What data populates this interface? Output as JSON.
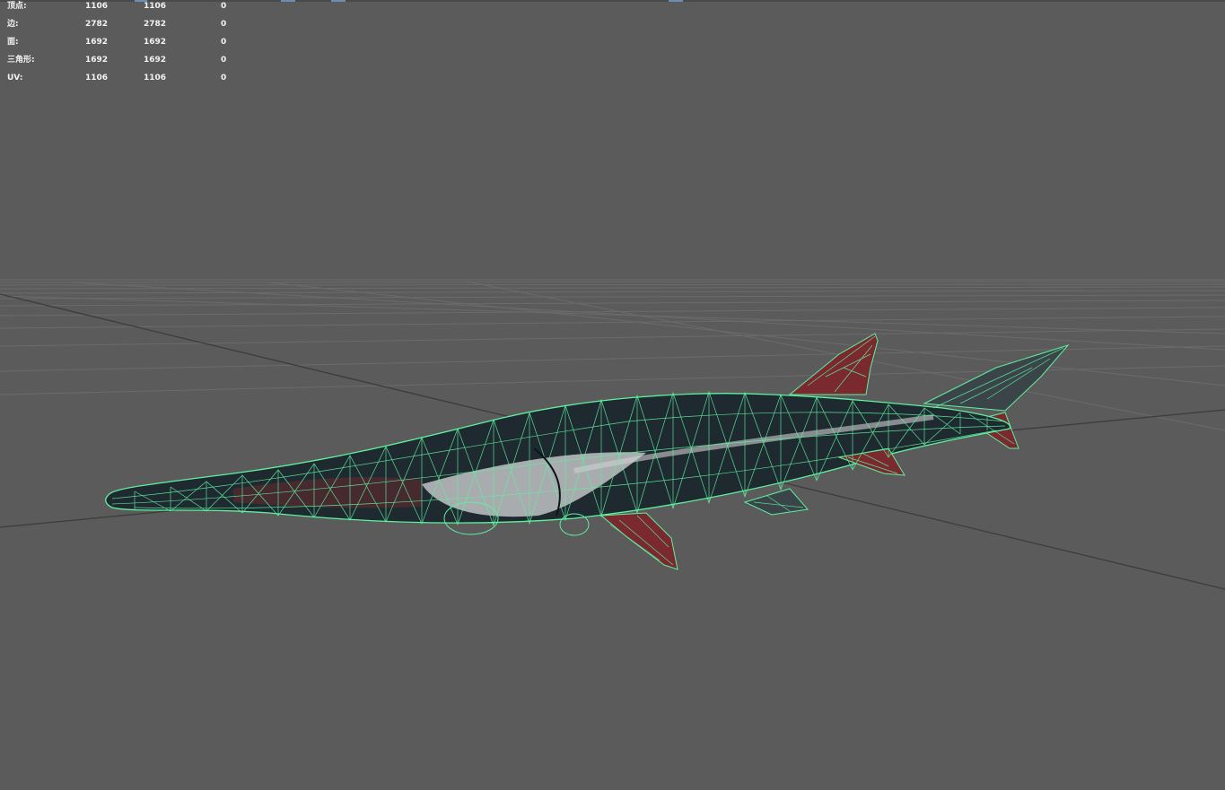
{
  "hud": {
    "rows": [
      {
        "label": "顶点:",
        "v1": "1106",
        "v2": "1106",
        "v3": "0"
      },
      {
        "label": "边:",
        "v1": "2782",
        "v2": "2782",
        "v3": "0"
      },
      {
        "label": "面:",
        "v1": "1692",
        "v2": "1692",
        "v3": "0"
      },
      {
        "label": "三角形:",
        "v1": "1692",
        "v2": "1692",
        "v3": "0"
      },
      {
        "label": "UV:",
        "v1": "1106",
        "v2": "1106",
        "v3": "0"
      }
    ]
  },
  "scene": {
    "model": "paddlefish-wireframe",
    "colors": {
      "background": "#5b5b5b",
      "grid": "#6b6b6b",
      "axis": "#3c3c3c",
      "wireframe": "#5ff0a0",
      "body_dark": "#1e2a30",
      "belly_light": "#d8d8d8",
      "fin_red": "#7a2a2e"
    }
  }
}
